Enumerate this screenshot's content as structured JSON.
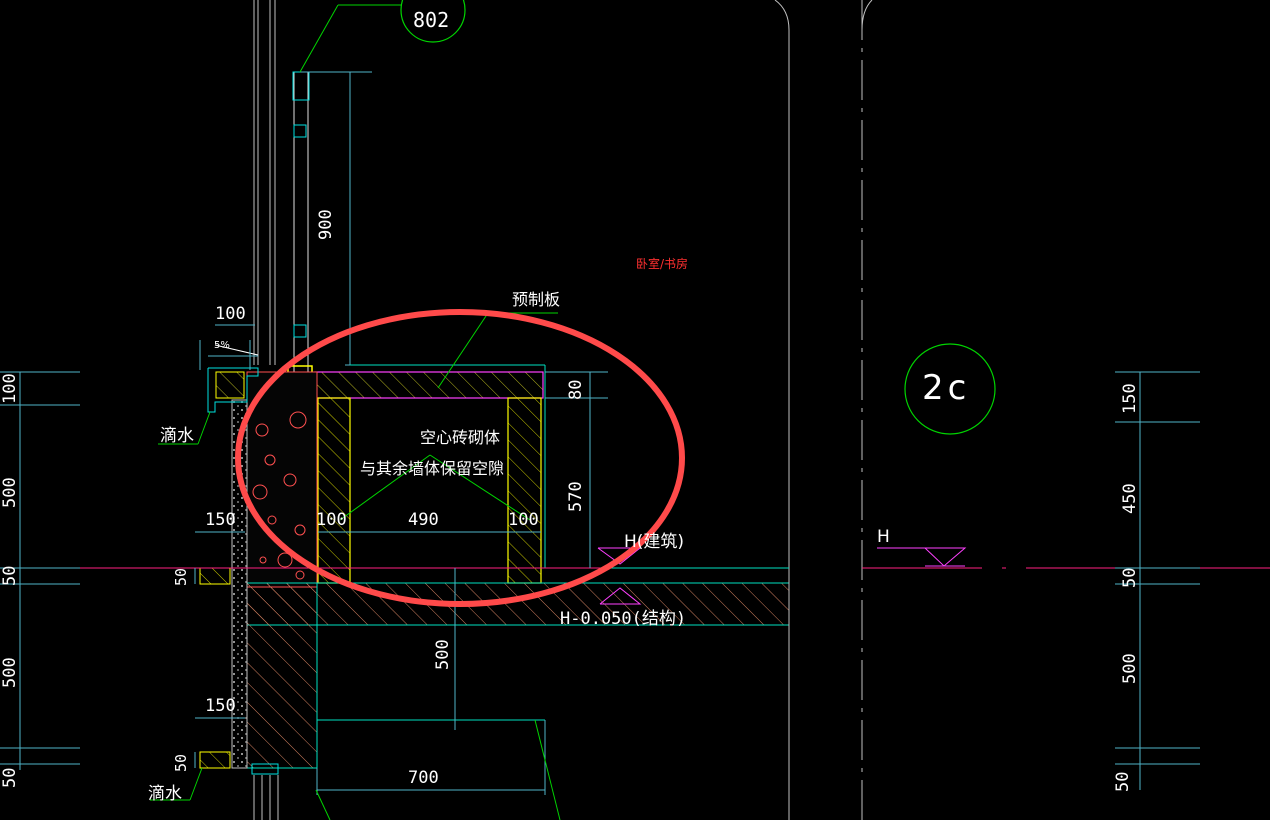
{
  "labels": {
    "callout_802": "802",
    "room": "卧室/书房",
    "prefab_slab": "预制板",
    "hollow_brick": "空心砖砌体",
    "gap_note": "与其余墙体保留空隙",
    "drip_top": "滴水",
    "drip_bottom": "滴水",
    "slope": "5%",
    "elev_arch": "H(建筑)",
    "elev_struct": "H-0.050(结构)",
    "elev_right": "H",
    "axis_2c": "2c"
  },
  "dimensions": {
    "d900": "900",
    "d100_top": "100",
    "d80": "80",
    "d570": "570",
    "d100_left": "100",
    "d490": "490",
    "d100_right": "100",
    "d150_top": "150",
    "d150_bottom": "150",
    "d500_mid": "500",
    "d700": "700",
    "left_100": "100",
    "left_500a": "500",
    "left_50a": "50",
    "left_500b": "500",
    "left_50b": "50",
    "inner_50a": "50",
    "inner_50b": "50",
    "right_150": "150",
    "right_450": "450",
    "right_50a": "50",
    "right_500": "500",
    "right_50b": "50"
  },
  "colors": {
    "background": "#000000",
    "dim_line": "#4fb3c8",
    "dim_text": "#ffffff",
    "leader": "#00d400",
    "wall_outline": "#00e0c0",
    "hatch": "#ff40ff",
    "brick": "#ffff00",
    "concrete": "#ff5050",
    "annotation_red": "#ff3030",
    "axis_pink": "#ff2080",
    "circle_green": "#00d400",
    "highlight_ellipse": "#ff4a4a"
  }
}
